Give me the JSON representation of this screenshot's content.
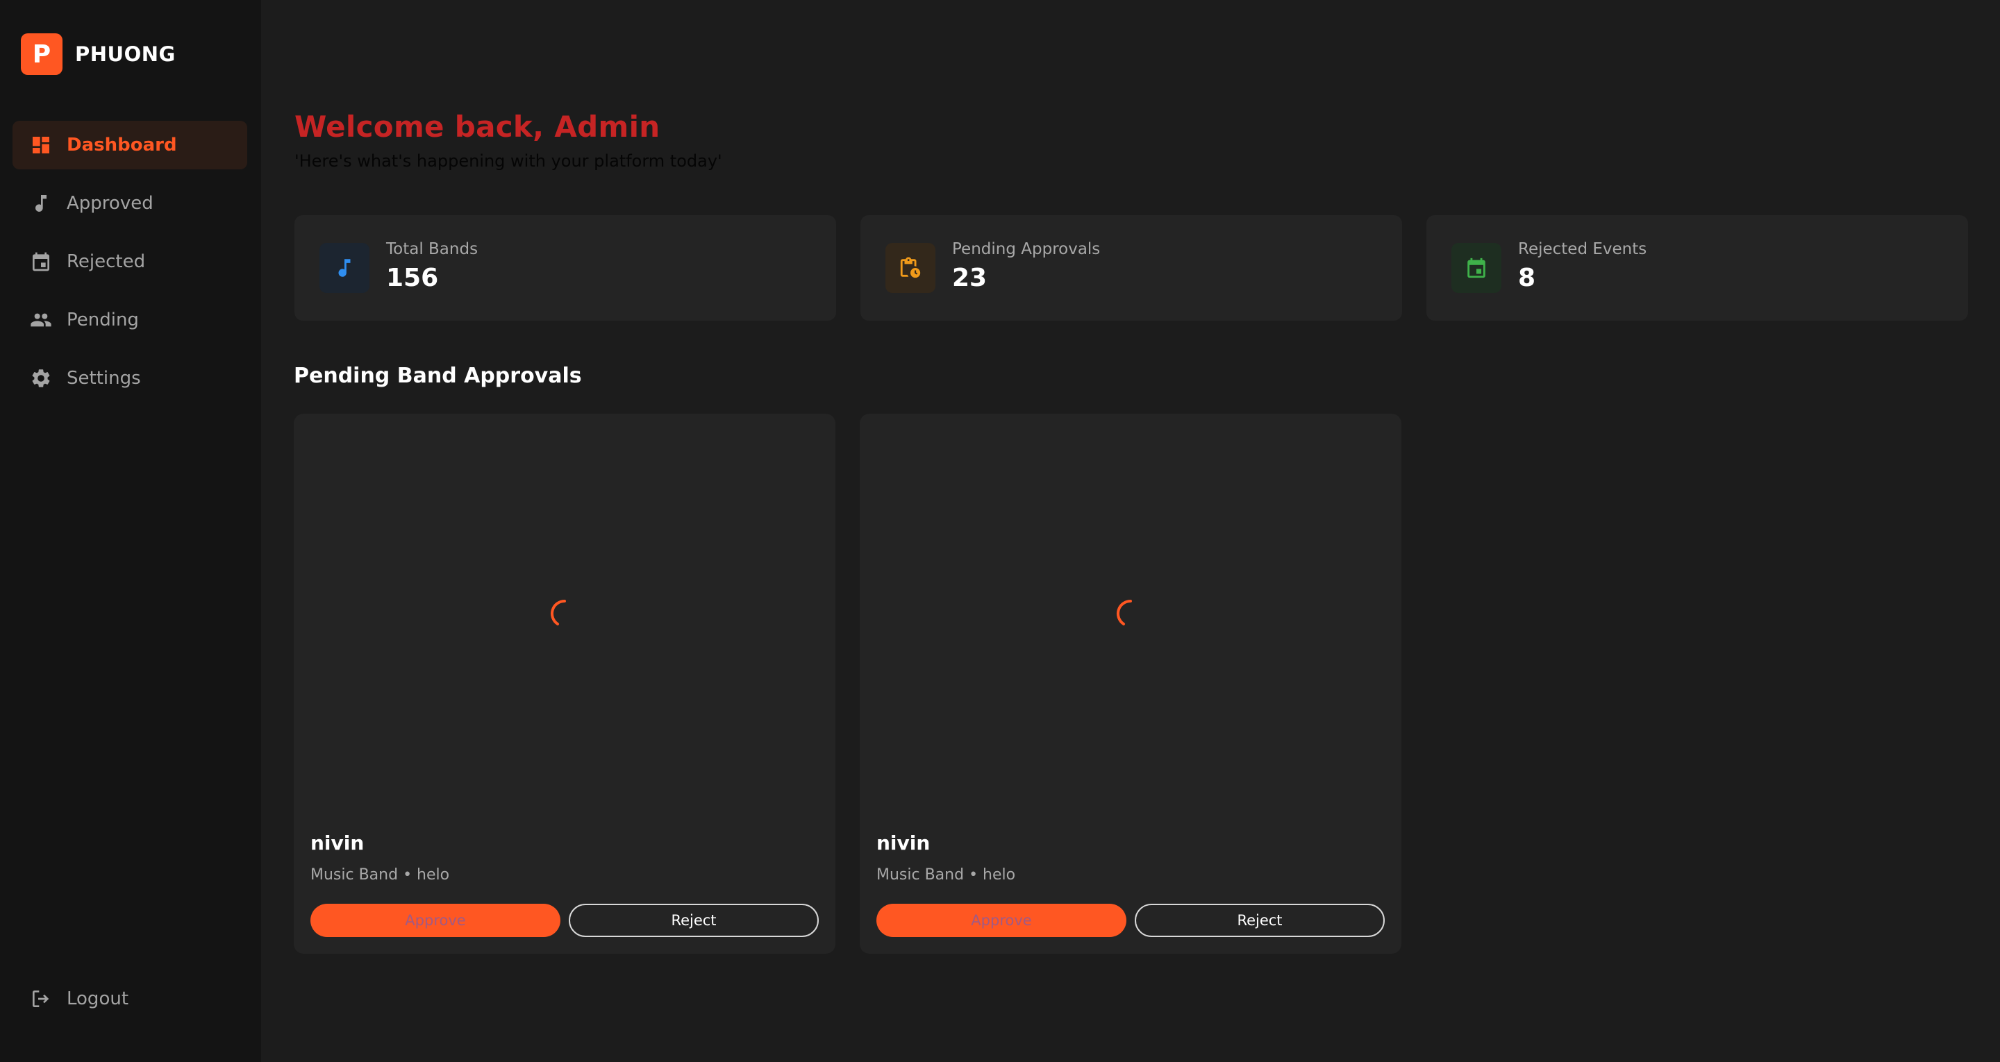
{
  "brand": {
    "letter": "P",
    "name": "PHUONG"
  },
  "sidebar": {
    "items": [
      {
        "label": "Dashboard",
        "icon": "dashboard-icon",
        "active": true
      },
      {
        "label": "Approved",
        "icon": "music-note-icon"
      },
      {
        "label": "Rejected",
        "icon": "calendar-icon"
      },
      {
        "label": "Pending",
        "icon": "people-icon"
      },
      {
        "label": "Settings",
        "icon": "gear-icon"
      }
    ],
    "logout_label": "Logout"
  },
  "header": {
    "title": "Welcome back, Admin",
    "subtitle": "'Here's what's happening with your platform today'"
  },
  "stats": [
    {
      "label": "Total Bands",
      "value": "156",
      "icon": "music-note-icon",
      "icon_color": "#2f8ef0",
      "icon_bg": "#1c2530"
    },
    {
      "label": "Pending Approvals",
      "value": "23",
      "icon": "clipboard-clock-icon",
      "icon_color": "#f09a1a",
      "icon_bg": "#33281b"
    },
    {
      "label": "Rejected Events",
      "value": "8",
      "icon": "calendar-icon",
      "icon_color": "#3fb24a",
      "icon_bg": "#1e2e21"
    }
  ],
  "pending": {
    "title": "Pending Band Approvals",
    "cards": [
      {
        "name": "nivin",
        "meta": "Music Band • helo",
        "approve_label": "Approve",
        "reject_label": "Reject"
      },
      {
        "name": "nivin",
        "meta": "Music Band • helo",
        "approve_label": "Approve",
        "reject_label": "Reject"
      }
    ]
  },
  "colors": {
    "accent": "#ff5722",
    "welcome": "#c62424",
    "sidebar_bg": "#141414",
    "main_bg": "#1c1c1c",
    "card_bg": "#242424"
  }
}
